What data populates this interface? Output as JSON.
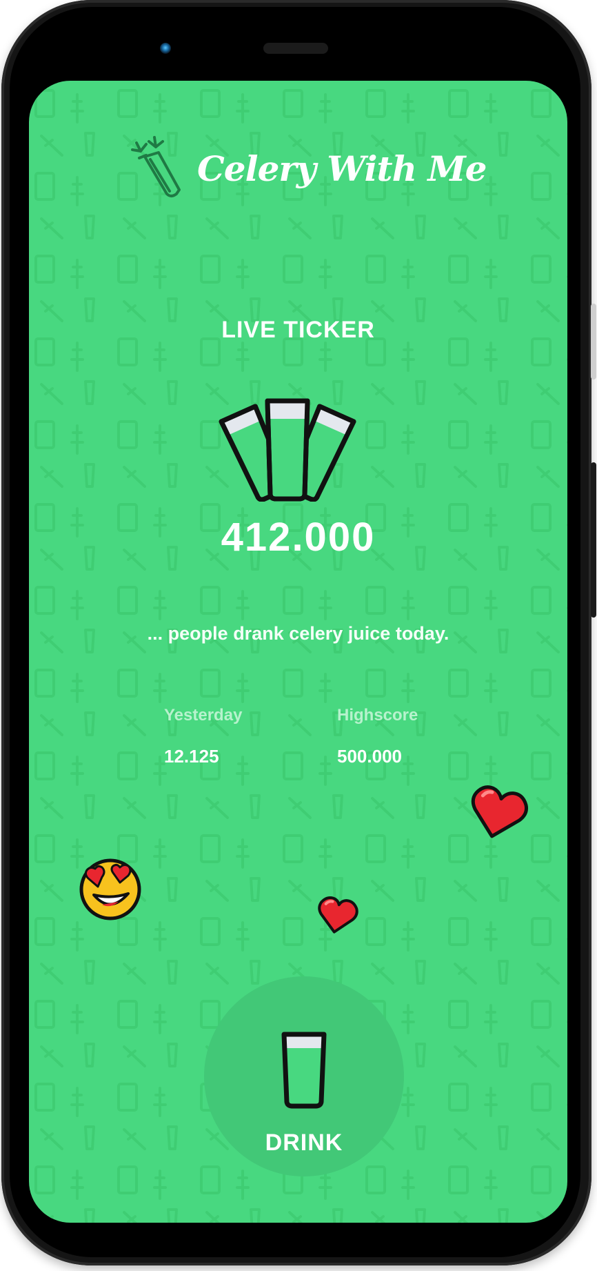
{
  "app": {
    "title": "Celery With Me",
    "logo_icon": "celery-icon"
  },
  "colors": {
    "background": "#48d880",
    "drink_button": "#42c877",
    "text": "#ffffff",
    "muted_text": "#b7f2cd",
    "heart": "#e8262f",
    "juice_top": "#e4e8ee"
  },
  "ticker": {
    "title": "LIVE TICKER",
    "value": "412.000",
    "caption": "... people drank celery juice today.",
    "icon": "juice-glasses-icon"
  },
  "stats": {
    "yesterday": {
      "label": "Yesterday",
      "value": "12.125"
    },
    "highscore": {
      "label": "Highscore",
      "value": "500.000"
    }
  },
  "reactions": [
    "heart-eyes-emoji",
    "heart-icon",
    "heart-icon"
  ],
  "drink_button": {
    "label": "DRINK",
    "icon": "glass-icon"
  }
}
